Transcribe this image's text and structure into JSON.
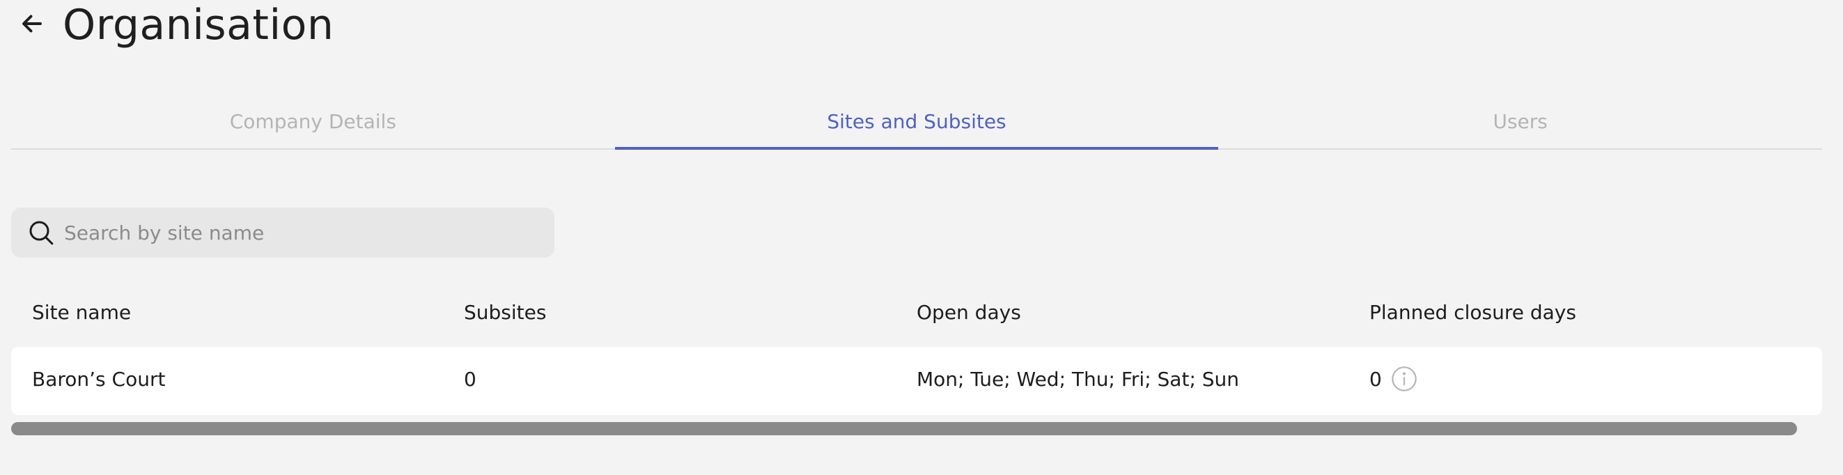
{
  "header": {
    "title": "Organisation",
    "back_icon": "arrow-left-icon"
  },
  "tabs": [
    {
      "label": "Company Details",
      "active": false
    },
    {
      "label": "Sites and Subsites",
      "active": true
    },
    {
      "label": "Users",
      "active": false
    }
  ],
  "search": {
    "placeholder": "Search by site name",
    "value": "",
    "icon": "search-icon"
  },
  "table": {
    "headers": [
      "Site name",
      "Subsites",
      "Open days",
      "Planned closure days"
    ],
    "rows": [
      {
        "site_name": "Baron’s Court",
        "subsites": "0",
        "open_days": "Mon; Tue; Wed; Thu; Fri; Sat; Sun",
        "planned_closure_days": "0",
        "closure_info_icon": "info-icon"
      }
    ]
  },
  "colors": {
    "accent": "#4f62c5",
    "background": "#f3f3f3",
    "inactive_tab": "#b4b4b4",
    "scrollbar": "#8a8a8a"
  }
}
